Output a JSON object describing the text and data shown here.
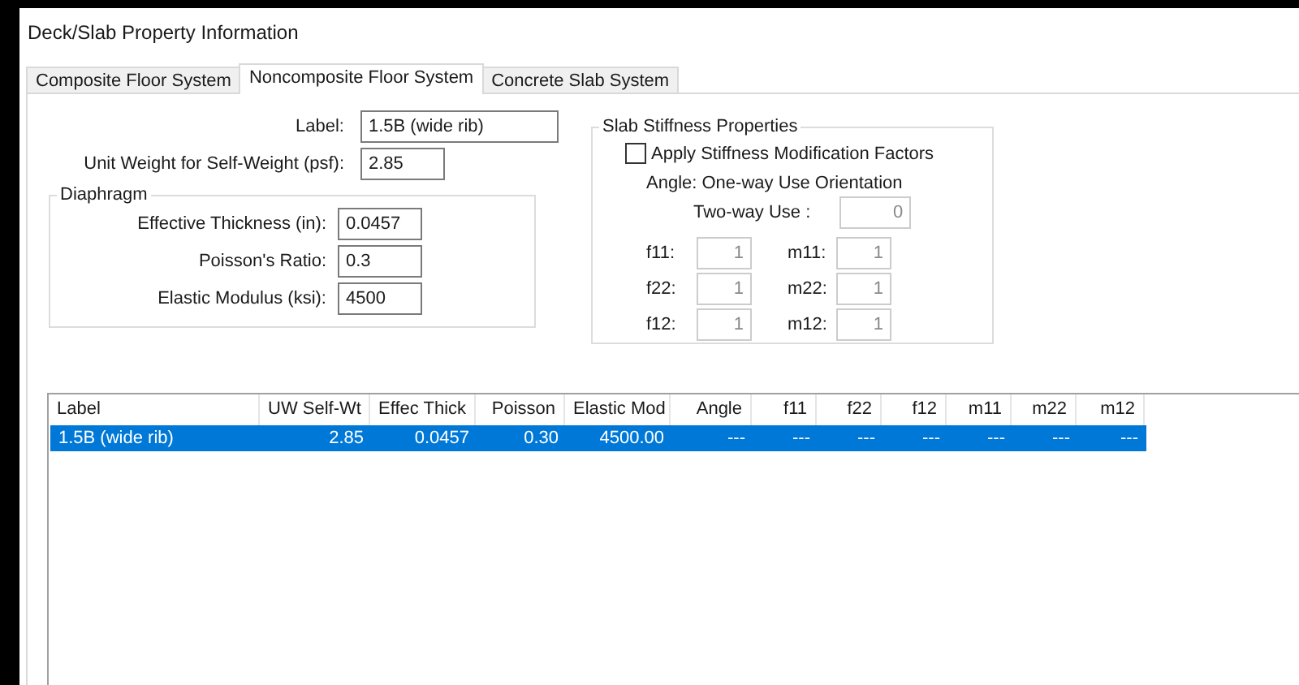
{
  "window": {
    "title": "Deck/Slab Property Information"
  },
  "tabs": [
    {
      "label": "Composite Floor System",
      "selected": false
    },
    {
      "label": "Noncomposite Floor System",
      "selected": true
    },
    {
      "label": "Concrete Slab System",
      "selected": false
    }
  ],
  "general": [
    {
      "label": "Label:",
      "value": "1.5B (wide rib)"
    },
    {
      "label": "Unit Weight for Self-Weight (psf):",
      "value": "2.85"
    }
  ],
  "diaphragm": {
    "title": "Diaphragm",
    "fields": [
      {
        "label": "Effective Thickness (in):",
        "value": "0.0457"
      },
      {
        "label": "Poisson's Ratio:",
        "value": "0.3"
      },
      {
        "label": "Elastic Modulus (ksi):",
        "value": "4500"
      }
    ]
  },
  "slab_stiffness": {
    "title": "Slab Stiffness Properties",
    "checkbox": {
      "label": "Apply Stiffness Modification Factors",
      "checked": false
    },
    "angle_caption": "Angle: One-way Use Orientation",
    "two_way": {
      "label": "Two-way Use :",
      "value": "0",
      "disabled": true
    },
    "factors": [
      {
        "label": "f11:",
        "value": "1",
        "disabled": true
      },
      {
        "label": "m11:",
        "value": "1",
        "disabled": true
      },
      {
        "label": "f22:",
        "value": "1",
        "disabled": true
      },
      {
        "label": "m22:",
        "value": "1",
        "disabled": true
      },
      {
        "label": "f12:",
        "value": "1",
        "disabled": true
      },
      {
        "label": "m12:",
        "value": "1",
        "disabled": true
      }
    ]
  },
  "table": {
    "columns": [
      "Label",
      "UW Self-Wt",
      "Effec Thick",
      "Poisson",
      "Elastic Mod",
      "Angle",
      "f11",
      "f22",
      "f12",
      "m11",
      "m22",
      "m12"
    ],
    "rows": [
      {
        "cells": [
          "1.5B (wide rib)",
          "2.85",
          "0.0457",
          "0.30",
          "4500.00",
          "---",
          "---",
          "---",
          "---",
          "---",
          "---",
          "---"
        ],
        "selected": true
      }
    ]
  }
}
